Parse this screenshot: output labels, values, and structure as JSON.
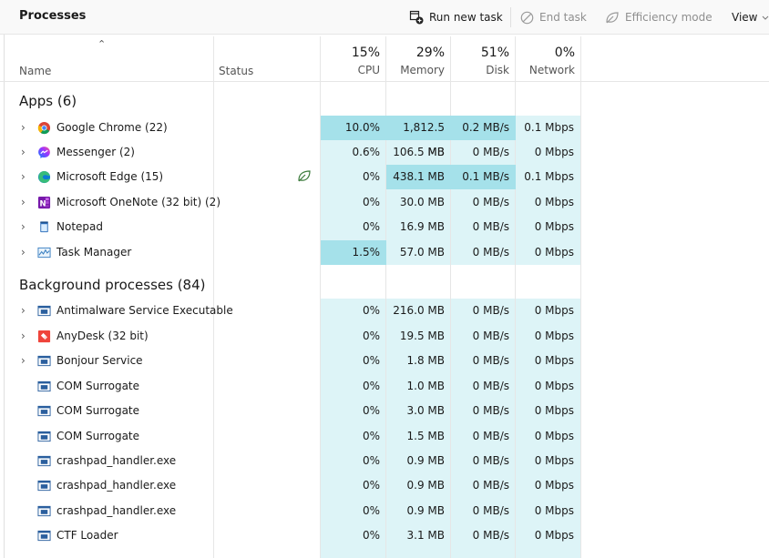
{
  "toolbar": {
    "title": "Processes",
    "run_new_task": "Run new task",
    "end_task": "End task",
    "efficiency_mode": "Efficiency mode",
    "view": "View"
  },
  "header": {
    "name": "Name",
    "status": "Status",
    "cpu_pct": "15%",
    "cpu": "CPU",
    "memory_pct": "29%",
    "memory": "Memory",
    "disk_pct": "51%",
    "disk": "Disk",
    "network_pct": "0%",
    "network": "Network"
  },
  "sections": {
    "apps": "Apps (6)",
    "background": "Background processes (84)"
  },
  "apps": [
    {
      "name": "Google Chrome (22)",
      "cpu": "10.0%",
      "memory": "1,812.5 MB",
      "disk": "0.2 MB/s",
      "network": "0.1 Mbps",
      "icon": "chrome-icon"
    },
    {
      "name": "Messenger (2)",
      "cpu": "0.6%",
      "memory": "106.5 MB",
      "disk": "0 MB/s",
      "network": "0 Mbps",
      "icon": "messenger-icon"
    },
    {
      "name": "Microsoft Edge (15)",
      "cpu": "0%",
      "memory": "438.1 MB",
      "disk": "0.1 MB/s",
      "network": "0.1 Mbps",
      "icon": "edge-icon"
    },
    {
      "name": "Microsoft OneNote (32 bit) (2)",
      "cpu": "0%",
      "memory": "30.0 MB",
      "disk": "0 MB/s",
      "network": "0 Mbps",
      "icon": "onenote-icon"
    },
    {
      "name": "Notepad",
      "cpu": "0%",
      "memory": "16.9 MB",
      "disk": "0 MB/s",
      "network": "0 Mbps",
      "icon": "notepad-icon"
    },
    {
      "name": "Task Manager",
      "cpu": "1.5%",
      "memory": "57.0 MB",
      "disk": "0 MB/s",
      "network": "0 Mbps",
      "icon": "task-manager-icon"
    }
  ],
  "background": [
    {
      "name": "Antimalware Service Executable",
      "cpu": "0%",
      "memory": "216.0 MB",
      "disk": "0 MB/s",
      "network": "0 Mbps",
      "icon": "service-icon"
    },
    {
      "name": "AnyDesk (32 bit)",
      "cpu": "0%",
      "memory": "19.5 MB",
      "disk": "0 MB/s",
      "network": "0 Mbps",
      "icon": "anydesk-icon"
    },
    {
      "name": "Bonjour Service",
      "cpu": "0%",
      "memory": "1.8 MB",
      "disk": "0 MB/s",
      "network": "0 Mbps",
      "icon": "service-icon"
    },
    {
      "name": "COM Surrogate",
      "cpu": "0%",
      "memory": "1.0 MB",
      "disk": "0 MB/s",
      "network": "0 Mbps",
      "icon": "service-icon"
    },
    {
      "name": "COM Surrogate",
      "cpu": "0%",
      "memory": "3.0 MB",
      "disk": "0 MB/s",
      "network": "0 Mbps",
      "icon": "service-icon"
    },
    {
      "name": "COM Surrogate",
      "cpu": "0%",
      "memory": "1.5 MB",
      "disk": "0 MB/s",
      "network": "0 Mbps",
      "icon": "service-icon"
    },
    {
      "name": "crashpad_handler.exe",
      "cpu": "0%",
      "memory": "0.9 MB",
      "disk": "0 MB/s",
      "network": "0 Mbps",
      "icon": "service-icon"
    },
    {
      "name": "crashpad_handler.exe",
      "cpu": "0%",
      "memory": "0.9 MB",
      "disk": "0 MB/s",
      "network": "0 Mbps",
      "icon": "service-icon"
    },
    {
      "name": "crashpad_handler.exe",
      "cpu": "0%",
      "memory": "0.9 MB",
      "disk": "0 MB/s",
      "network": "0 Mbps",
      "icon": "service-icon"
    },
    {
      "name": "CTF Loader",
      "cpu": "0%",
      "memory": "3.1 MB",
      "disk": "0 MB/s",
      "network": "0 Mbps",
      "icon": "service-icon"
    }
  ]
}
